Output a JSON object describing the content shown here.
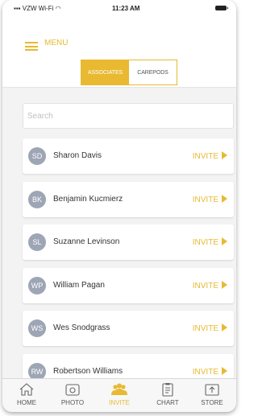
{
  "status_bar": {
    "carrier": "VZW Wi-Fi",
    "time": "11:23 AM"
  },
  "header": {
    "menu_label": "MENU",
    "segments": [
      {
        "label": "ASSOCIATES",
        "active": true
      },
      {
        "label": "CAREPODS",
        "active": false
      }
    ]
  },
  "search": {
    "placeholder": "Search"
  },
  "associates": [
    {
      "initials": "SD",
      "name": "Sharon Davis",
      "action": "INVITE"
    },
    {
      "initials": "BK",
      "name": "Benjamin Kucmierz",
      "action": "INVITE"
    },
    {
      "initials": "SL",
      "name": "Suzanne Levinson",
      "action": "INVITE"
    },
    {
      "initials": "WP",
      "name": "William Pagan",
      "action": "INVITE"
    },
    {
      "initials": "WS",
      "name": "Wes Snodgrass",
      "action": "INVITE"
    },
    {
      "initials": "RW",
      "name": "Robertson Williams",
      "action": "INVITE"
    }
  ],
  "tabbar": {
    "items": [
      {
        "label": "HOME",
        "icon": "home-icon",
        "active": false
      },
      {
        "label": "PHOTO",
        "icon": "camera-icon",
        "active": false
      },
      {
        "label": "INVITE",
        "icon": "people-icon",
        "active": true
      },
      {
        "label": "CHART",
        "icon": "clipboard-icon",
        "active": false
      },
      {
        "label": "STORE",
        "icon": "store-icon",
        "active": false
      }
    ]
  },
  "colors": {
    "accent": "#e8b931",
    "avatar": "#9ea5b5",
    "background": "#f3f3f3"
  }
}
